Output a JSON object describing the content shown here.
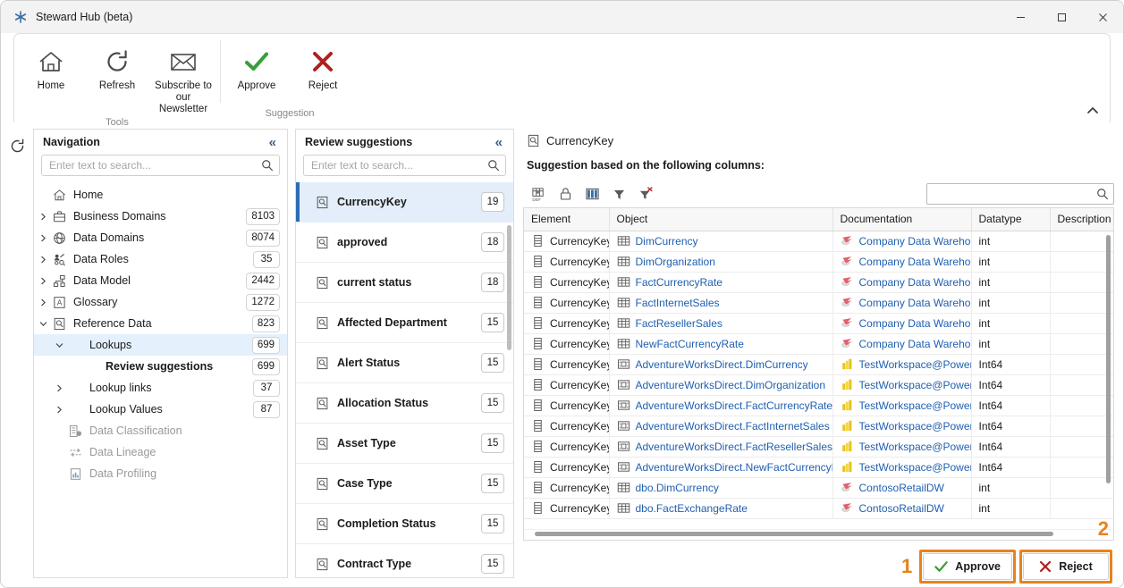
{
  "window": {
    "title": "Steward Hub (beta)",
    "app_icon": "asterisk-snowflake-icon",
    "minimize": "—",
    "maximize": "□",
    "close": "✕"
  },
  "ribbon": {
    "groups": [
      {
        "title": "Tools",
        "buttons": [
          {
            "label": "Home",
            "icon": "home-icon"
          },
          {
            "label": "Refresh",
            "icon": "refresh-icon"
          },
          {
            "label": "Subscribe to our Newsletter",
            "icon": "envelope-icon"
          }
        ]
      },
      {
        "title": "Suggestion",
        "buttons": [
          {
            "label": "Approve",
            "icon": "green-check-icon"
          },
          {
            "label": "Reject",
            "icon": "red-cross-icon"
          }
        ]
      }
    ],
    "collapse_icon": "chevron-up-icon"
  },
  "rail": {
    "refresh_icon": "refresh-icon"
  },
  "navigation": {
    "title": "Navigation",
    "collapse_icon": "double-chevron-left-icon",
    "search": {
      "placeholder": "Enter text to search...",
      "value": "",
      "icon": "search-icon"
    },
    "items": [
      {
        "label": "Home",
        "count": "",
        "icon": "home-icon",
        "twisty": "",
        "indent": 0,
        "state": "normal"
      },
      {
        "label": "Business Domains",
        "count": "8103",
        "icon": "briefcase-icon",
        "twisty": ">",
        "indent": 0,
        "state": "normal"
      },
      {
        "label": "Data Domains",
        "count": "8074",
        "icon": "globe-icon",
        "twisty": ">",
        "indent": 0,
        "state": "normal"
      },
      {
        "label": "Data Roles",
        "count": "35",
        "icon": "user-role-icon",
        "twisty": ">",
        "indent": 0,
        "state": "normal"
      },
      {
        "label": "Data Model",
        "count": "2442",
        "icon": "data-model-icon",
        "twisty": ">",
        "indent": 0,
        "state": "normal"
      },
      {
        "label": "Glossary",
        "count": "1272",
        "icon": "glossary-icon",
        "twisty": ">",
        "indent": 0,
        "state": "normal"
      },
      {
        "label": "Reference Data",
        "count": "823",
        "icon": "reference-data-icon",
        "twisty": "v",
        "indent": 0,
        "state": "normal"
      },
      {
        "label": "Lookups",
        "count": "699",
        "icon": "",
        "twisty": "v",
        "indent": 1,
        "state": "selected"
      },
      {
        "label": "Review suggestions",
        "count": "699",
        "icon": "",
        "twisty": "",
        "indent": 2,
        "state": "bold"
      },
      {
        "label": "Lookup links",
        "count": "37",
        "icon": "",
        "twisty": ">",
        "indent": 1,
        "state": "normal"
      },
      {
        "label": "Lookup Values",
        "count": "87",
        "icon": "",
        "twisty": ">",
        "indent": 1,
        "state": "normal"
      },
      {
        "label": "Data Classification",
        "count": "",
        "icon": "classification-icon",
        "twisty": "",
        "indent": 1,
        "state": "disabled"
      },
      {
        "label": "Data Lineage",
        "count": "",
        "icon": "lineage-icon",
        "twisty": "",
        "indent": 1,
        "state": "disabled"
      },
      {
        "label": "Data Profiling",
        "count": "",
        "icon": "profiling-icon",
        "twisty": "",
        "indent": 1,
        "state": "disabled"
      }
    ]
  },
  "review": {
    "title": "Review suggestions",
    "collapse_icon": "double-chevron-left-icon",
    "search": {
      "placeholder": "Enter text to search...",
      "value": "",
      "icon": "search-icon"
    },
    "items": [
      {
        "label": "CurrencyKey",
        "count": "19",
        "selected": true
      },
      {
        "label": "approved",
        "count": "18",
        "selected": false
      },
      {
        "label": "current status",
        "count": "18",
        "selected": false
      },
      {
        "label": "Affected Department",
        "count": "15",
        "selected": false
      },
      {
        "label": "Alert Status",
        "count": "15",
        "selected": false
      },
      {
        "label": "Allocation Status",
        "count": "15",
        "selected": false
      },
      {
        "label": "Asset Type",
        "count": "15",
        "selected": false
      },
      {
        "label": "Case Type",
        "count": "15",
        "selected": false
      },
      {
        "label": "Completion Status",
        "count": "15",
        "selected": false
      },
      {
        "label": "Contract Type",
        "count": "15",
        "selected": false
      }
    ]
  },
  "main": {
    "title": "CurrencyKey",
    "title_icon": "reference-data-icon",
    "subtitle": "Suggestion based on the following columns:",
    "toolbar": [
      {
        "name": "group-by-icon",
        "tip": "Group"
      },
      {
        "name": "lock-icon",
        "tip": "Lock"
      },
      {
        "name": "columns-icon",
        "tip": "Columns"
      },
      {
        "name": "filter-icon",
        "tip": "Filter"
      },
      {
        "name": "clear-filter-icon",
        "tip": "Clear filter"
      }
    ],
    "search": {
      "placeholder": "",
      "value": "",
      "icon": "search-icon"
    },
    "grid": {
      "columns": [
        "Element",
        "Object",
        "Documentation",
        "Datatype",
        "Description"
      ],
      "rows": [
        {
          "element": "CurrencyKey",
          "object": "DimCurrency",
          "object_icon": "table-icon",
          "documentation": "Company Data Warehouse",
          "doc_icon": "sql-server-icon",
          "datatype": "int",
          "description": ""
        },
        {
          "element": "CurrencyKey",
          "object": "DimOrganization",
          "object_icon": "table-icon",
          "documentation": "Company Data Warehouse",
          "doc_icon": "sql-server-icon",
          "datatype": "int",
          "description": ""
        },
        {
          "element": "CurrencyKey",
          "object": "FactCurrencyRate",
          "object_icon": "table-icon",
          "documentation": "Company Data Warehouse",
          "doc_icon": "sql-server-icon",
          "datatype": "int",
          "description": ""
        },
        {
          "element": "CurrencyKey",
          "object": "FactInternetSales",
          "object_icon": "table-icon",
          "documentation": "Company Data Warehouse",
          "doc_icon": "sql-server-icon",
          "datatype": "int",
          "description": ""
        },
        {
          "element": "CurrencyKey",
          "object": "FactResellerSales",
          "object_icon": "table-icon",
          "documentation": "Company Data Warehouse",
          "doc_icon": "sql-server-icon",
          "datatype": "int",
          "description": ""
        },
        {
          "element": "CurrencyKey",
          "object": "NewFactCurrencyRate",
          "object_icon": "table-icon",
          "documentation": "Company Data Warehouse",
          "doc_icon": "sql-server-icon",
          "datatype": "int",
          "description": ""
        },
        {
          "element": "CurrencyKey",
          "object": "AdventureWorksDirect.DimCurrency",
          "object_icon": "dataset-icon",
          "documentation": "TestWorkspace@PowerBI",
          "doc_icon": "powerbi-icon",
          "datatype": "Int64",
          "description": ""
        },
        {
          "element": "CurrencyKey",
          "object": "AdventureWorksDirect.DimOrganization",
          "object_icon": "dataset-icon",
          "documentation": "TestWorkspace@PowerBI",
          "doc_icon": "powerbi-icon",
          "datatype": "Int64",
          "description": ""
        },
        {
          "element": "CurrencyKey",
          "object": "AdventureWorksDirect.FactCurrencyRate",
          "object_icon": "dataset-icon",
          "documentation": "TestWorkspace@PowerBI",
          "doc_icon": "powerbi-icon",
          "datatype": "Int64",
          "description": ""
        },
        {
          "element": "CurrencyKey",
          "object": "AdventureWorksDirect.FactInternetSales",
          "object_icon": "dataset-icon",
          "documentation": "TestWorkspace@PowerBI",
          "doc_icon": "powerbi-icon",
          "datatype": "Int64",
          "description": ""
        },
        {
          "element": "CurrencyKey",
          "object": "AdventureWorksDirect.FactResellerSales",
          "object_icon": "dataset-icon",
          "documentation": "TestWorkspace@PowerBI",
          "doc_icon": "powerbi-icon",
          "datatype": "Int64",
          "description": ""
        },
        {
          "element": "CurrencyKey",
          "object": "AdventureWorksDirect.NewFactCurrencyRate",
          "object_icon": "dataset-icon",
          "documentation": "TestWorkspace@PowerBI",
          "doc_icon": "powerbi-icon",
          "datatype": "Int64",
          "description": ""
        },
        {
          "element": "CurrencyKey",
          "object": "dbo.DimCurrency",
          "object_icon": "table-icon",
          "documentation": "ContosoRetailDW",
          "doc_icon": "sql-server-icon",
          "datatype": "int",
          "description": ""
        },
        {
          "element": "CurrencyKey",
          "object": "dbo.FactExchangeRate",
          "object_icon": "table-icon",
          "documentation": "ContosoRetailDW",
          "doc_icon": "sql-server-icon",
          "datatype": "int",
          "description": ""
        }
      ]
    }
  },
  "actions": {
    "annotation_1": "1",
    "annotation_2": "2",
    "approve_label": "Approve",
    "reject_label": "Reject",
    "approve_icon": "green-check-icon",
    "reject_icon": "red-cross-icon",
    "highlight_color": "#e8821e"
  }
}
